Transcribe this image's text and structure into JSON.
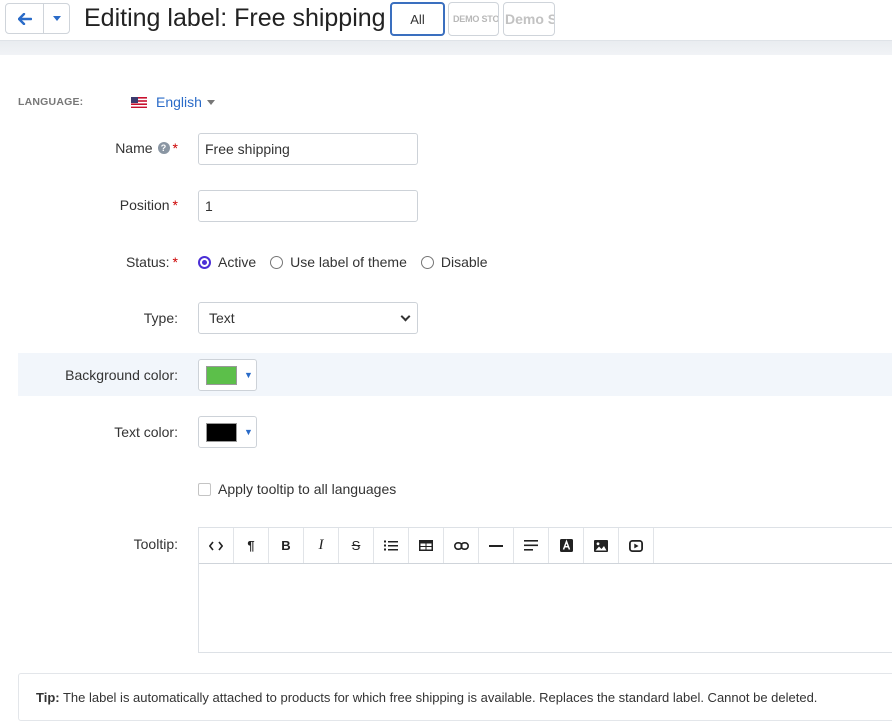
{
  "header": {
    "title": "Editing label: Free shipping",
    "stores": [
      {
        "label": "All",
        "selected": true
      },
      {
        "label": "DEMO STORE"
      },
      {
        "label": "Demo Sto"
      }
    ]
  },
  "language": {
    "label": "LANGUAGE:",
    "value": "English",
    "flag_icon": "us-flag-icon"
  },
  "form": {
    "name": {
      "label": "Name",
      "value": "Free shipping",
      "required": true,
      "help_icon": "question-circle-icon"
    },
    "position": {
      "label": "Position",
      "value": "1",
      "required": true
    },
    "status": {
      "label": "Status:",
      "required": true,
      "options": [
        "Active",
        "Use label of theme",
        "Disable"
      ],
      "selected": "Active"
    },
    "type": {
      "label": "Type:",
      "value": "Text"
    },
    "background_color": {
      "label": "Background color:",
      "value": "#5cbf4a"
    },
    "text_color": {
      "label": "Text color:",
      "value": "#000000"
    },
    "apply_tooltip": {
      "label": "Apply tooltip to all languages",
      "checked": false
    },
    "tooltip": {
      "label": "Tooltip:"
    }
  },
  "editor": {
    "tools": [
      "code-view-icon",
      "paragraph-icon",
      "bold-icon",
      "italic-icon",
      "strikethrough-icon",
      "unordered-list-icon",
      "table-icon",
      "link-icon",
      "horizontal-rule-icon",
      "align-icon",
      "font-color-icon",
      "image-icon",
      "video-icon"
    ],
    "tool_glyphs": {
      "paragraph": "¶",
      "bold": "B",
      "italic": "I",
      "strike": "S"
    }
  },
  "tip": {
    "label": "Tip:",
    "text": " The label is automatically attached to products for which free shipping is available. Replaces the standard label. Cannot be deleted."
  },
  "colors": {
    "accent": "#2a6bc8",
    "radio_accent": "#4b2fd6",
    "required": "#cc0000"
  }
}
